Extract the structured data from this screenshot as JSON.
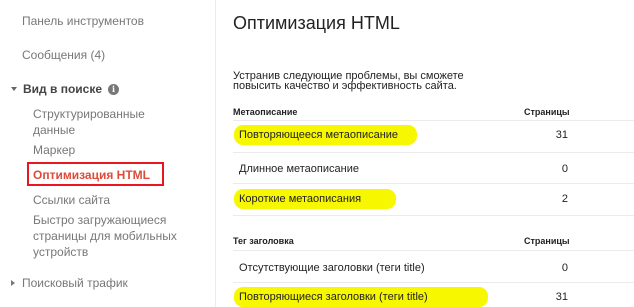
{
  "sidebar": {
    "dashboard": "Панель инструментов",
    "messages": "Сообщения (4)",
    "search_view": {
      "label": "Вид в поиске",
      "info_glyph": "i",
      "items": [
        "Структурированные",
        "данные",
        "Маркер",
        "Оптимизация HTML",
        "Ссылки сайта",
        "Быстро загружающиеся",
        "страницы для мобильных",
        "устройств"
      ]
    },
    "search_traffic": "Поисковый трафик"
  },
  "main": {
    "title": "Оптимизация HTML",
    "description_line1": "Устранив следующие проблемы, вы сможете",
    "description_line2": "повысить качество и эффективность сайта.",
    "meta_table": {
      "header_left": "Метаописание",
      "header_right": "Страницы",
      "rows": [
        {
          "label": "Повторяющееся метаописание",
          "value": "31"
        },
        {
          "label": "Длинное метаописание",
          "value": "0"
        },
        {
          "label": "Короткие метаописания",
          "value": "2"
        }
      ]
    },
    "title_table": {
      "header_left": "Тег заголовка",
      "header_right": "Страницы",
      "rows": [
        {
          "label": "Отсутствующие заголовки (теги title)",
          "value": "0"
        },
        {
          "label": "Повторяющиеся заголовки (теги title)",
          "value": "31"
        }
      ]
    }
  },
  "colors": {
    "active_item": "#dd4b39",
    "annotation_box": "#e8171f",
    "highlight": "#f7f700"
  }
}
